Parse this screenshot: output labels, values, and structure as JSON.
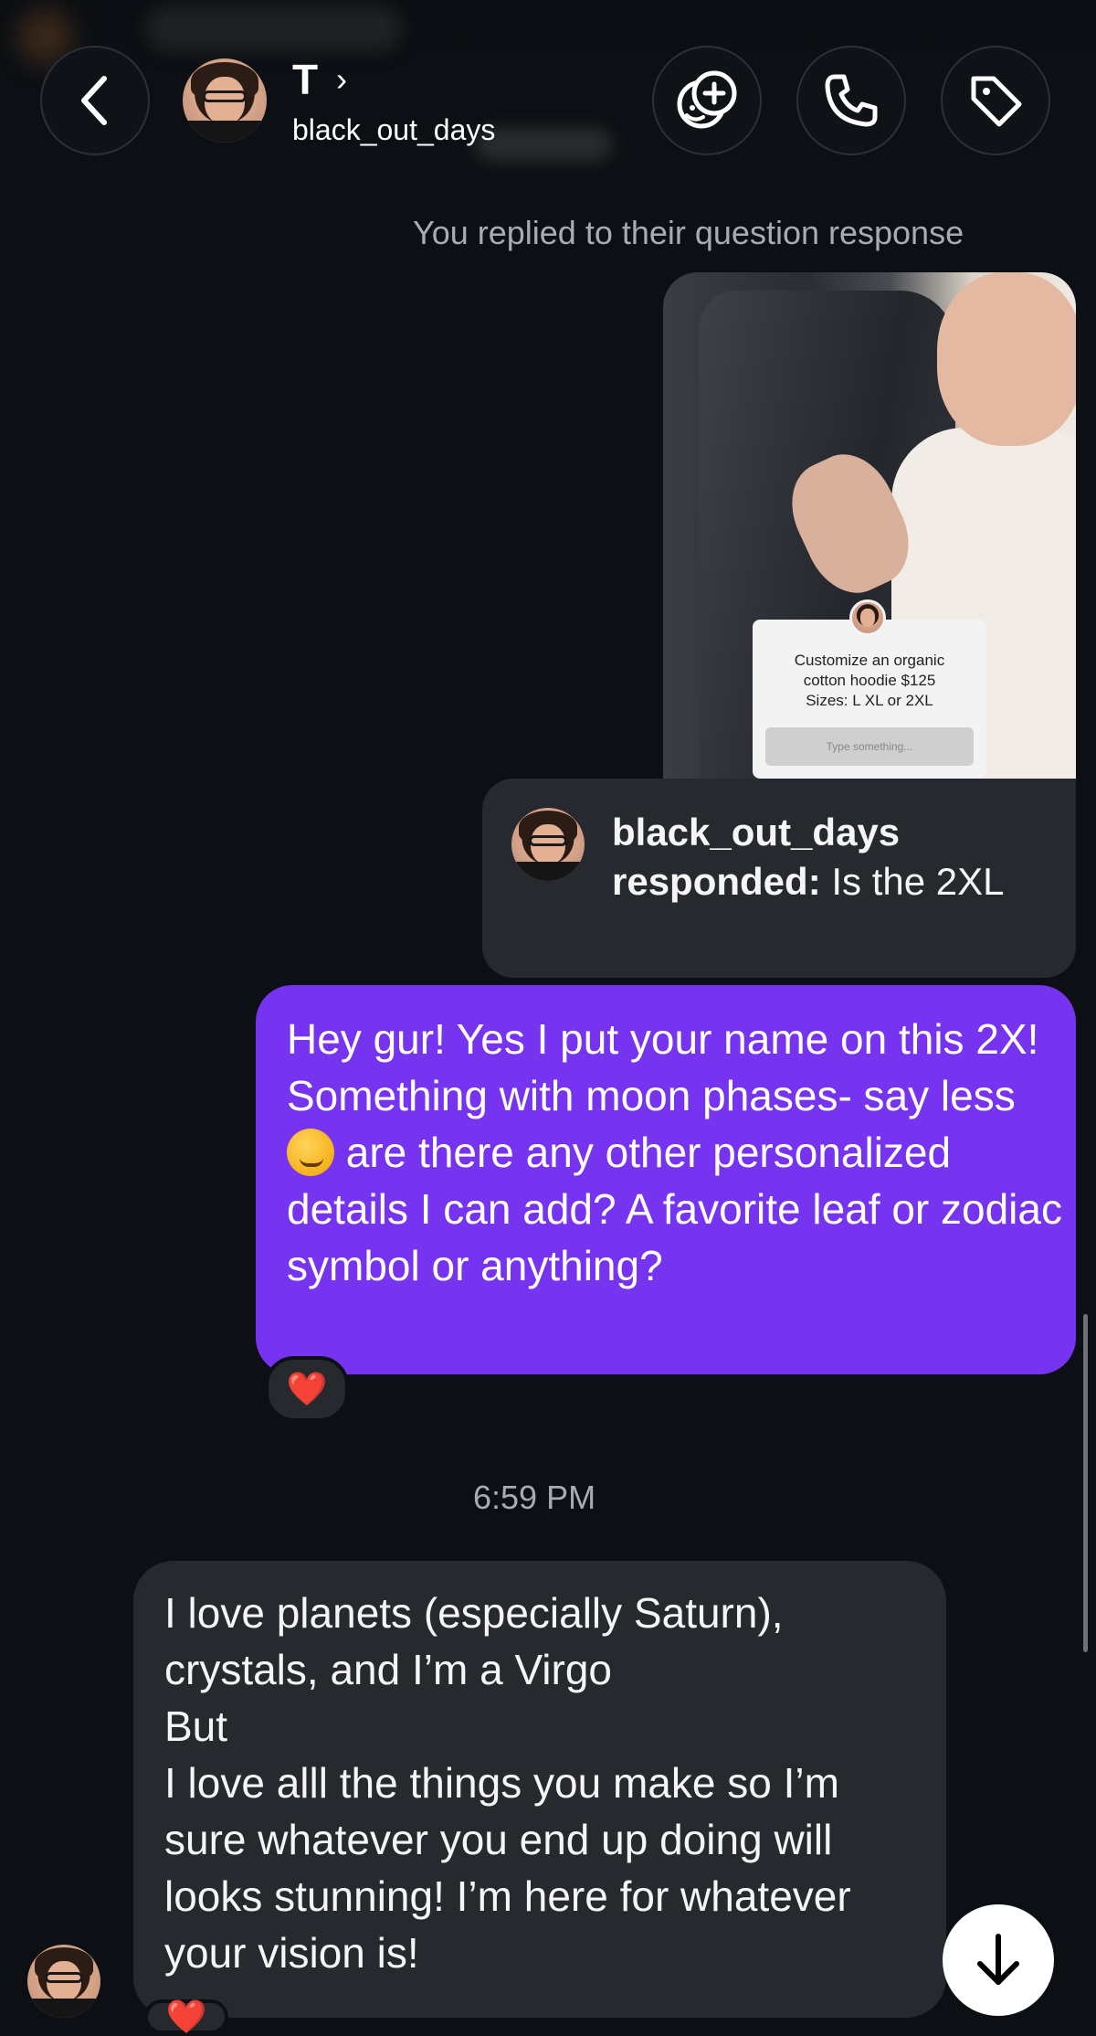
{
  "header": {
    "name": "T",
    "username": "black_out_days",
    "buttons": {
      "back": "back-icon",
      "effects": "face-effects-icon",
      "call": "phone-icon",
      "tag": "tag-icon"
    }
  },
  "thread": {
    "reply_notice": "You replied to their question response",
    "story": {
      "question_text": "Customize an organic\ncotton hoodie $125\nSizes: L XL or 2XL",
      "input_placeholder": "Type something..."
    },
    "response": {
      "username": "black_out_days",
      "label": "responded:",
      "text": "Is the 2XL"
    },
    "sent_message": {
      "text_part1": "Hey gur! Yes I put your name on this 2X! Something with moon phases- say less ",
      "emoji": "smirking-face",
      "text_part2": " are there any other personalized details I can add? A favorite leaf or zodiac symbol or anything?",
      "reaction": "❤️"
    },
    "timestamp": "6:59 PM",
    "received_message": {
      "lines": [
        "I love planets (especially Saturn), crystals, and I’m a Virgo",
        "But",
        "I love alll the things you make so I’m sure whatever you end up doing will looks stunning! I’m here for whatever your vision is!"
      ],
      "reaction": "❤️"
    }
  },
  "colors": {
    "background": "#0c1014",
    "sent_bubble": "#7734f0",
    "received_bubble": "#262a2f",
    "reaction_heart": "#ff3040"
  }
}
